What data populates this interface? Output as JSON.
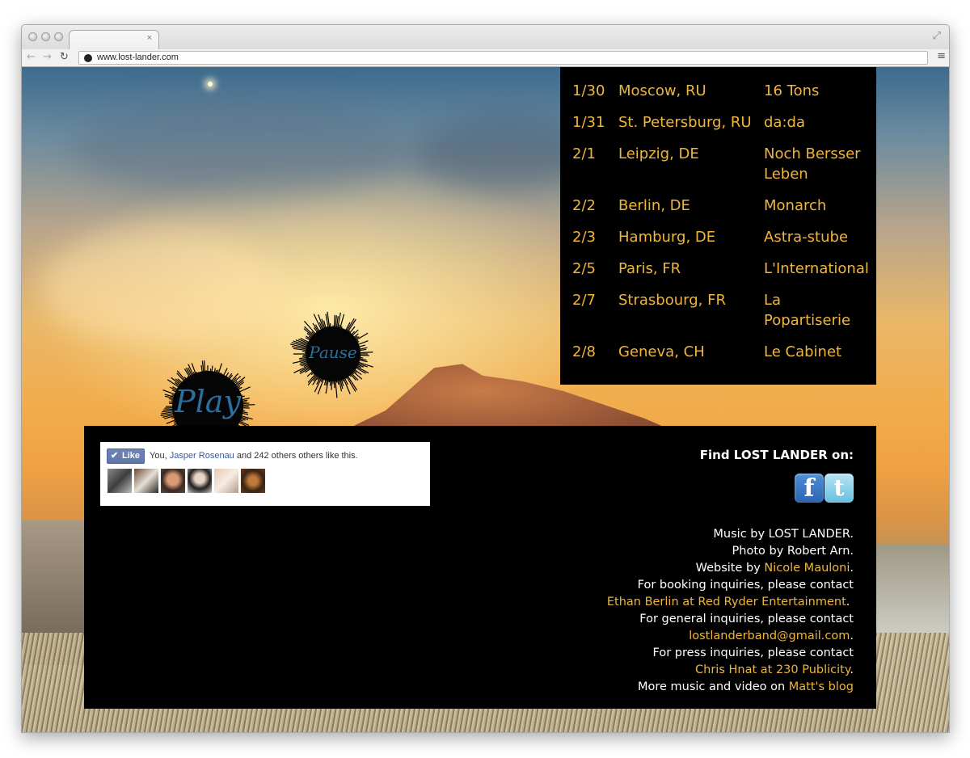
{
  "browser": {
    "url": "www.lost-lander.com",
    "tab_close": "×",
    "icons": {
      "back": "←",
      "forward": "→",
      "reload": "↻",
      "menu": "≡",
      "resize": "⤢"
    }
  },
  "player": {
    "play_label": "Play",
    "pause_label": "Pause"
  },
  "tour": {
    "dates": [
      {
        "date": "1/30",
        "city": "Moscow, RU",
        "venue": "16 Tons"
      },
      {
        "date": "1/31",
        "city": "St. Petersburg, RU",
        "venue": "da:da"
      },
      {
        "date": "2/1",
        "city": "Leipzig, DE",
        "venue": "Noch Bersser Leben"
      },
      {
        "date": "2/2",
        "city": "Berlin, DE",
        "venue": "Monarch"
      },
      {
        "date": "2/3",
        "city": "Hamburg, DE",
        "venue": "Astra-stube"
      },
      {
        "date": "2/5",
        "city": "Paris, FR",
        "venue": "L'International"
      },
      {
        "date": "2/7",
        "city": "Strasbourg, FR",
        "venue": "La Popartiserie"
      },
      {
        "date": "2/8",
        "city": "Geneva, CH",
        "venue": "Le Cabinet"
      }
    ]
  },
  "facebook_widget": {
    "like_label": "Like",
    "prefix": "You, ",
    "friend_name": "Jasper Rosenau",
    "suffix": " and 242 others others like this."
  },
  "social": {
    "heading": "Find LOST LANDER on:",
    "facebook_glyph": "f",
    "twitter_glyph": "t"
  },
  "credits": {
    "music": "Music by LOST LANDER.",
    "photo": "Photo by Robert Arn.",
    "website_prefix": "Website by ",
    "website_link": "Nicole Mauloni",
    "website_suffix": ".",
    "booking_text": "For booking inquiries, please contact",
    "booking_link": "Ethan Berlin at Red Ryder Entertainment",
    "booking_suffix": ".",
    "general_text": "For general inquiries, please contact",
    "general_link": "lostlanderband@gmail.com",
    "general_suffix": ".",
    "press_text": "For press inquiries, please contact",
    "press_link": "Chris Hnat at 230 Publicity",
    "press_suffix": ".",
    "more_prefix": "More music and video on ",
    "more_link": "Matt's blog"
  },
  "colors": {
    "accent": "#f0b53a",
    "panel": "#000000",
    "facebook_link": "#3b5998"
  }
}
